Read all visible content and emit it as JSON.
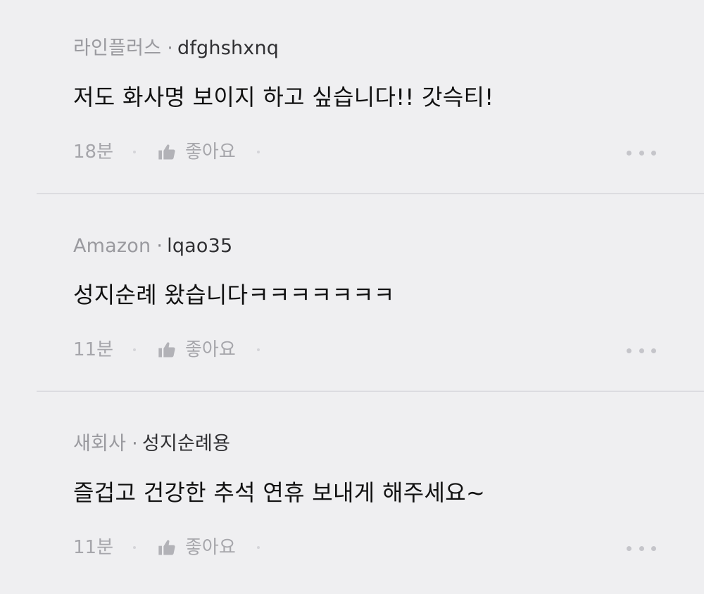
{
  "comments": [
    {
      "company": "라인플러스",
      "separator": "·",
      "user": "dfghshxnq",
      "text": "저도 화사명 보이지 하고 싶습니다!! 갓슥티!",
      "time": "18분",
      "like_label": "좋아요"
    },
    {
      "company": "Amazon",
      "separator": "·",
      "user": "lqao35",
      "text": "성지순례 왔습니다ㅋㅋㅋㅋㅋㅋㅋ",
      "time": "11분",
      "like_label": "좋아요"
    },
    {
      "company": "새회사",
      "separator": "·",
      "user": "성지순례용",
      "text": "즐겁고 건강한 추석 연휴 보내게 해주세요~",
      "time": "11분",
      "like_label": "좋아요"
    }
  ],
  "colors": {
    "background": "#efeff1",
    "text_primary": "#111111",
    "text_secondary": "#9a9a9f",
    "divider": "#dcdce0"
  },
  "icons": {
    "like": "thumbs-up-icon",
    "more": "more-horizontal-icon"
  }
}
